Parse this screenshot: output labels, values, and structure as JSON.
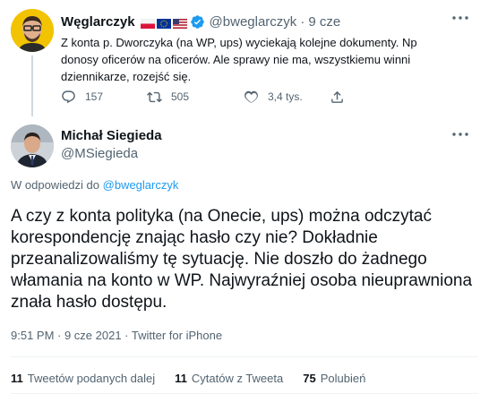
{
  "parent_tweet": {
    "author_name": "Węglarczyk",
    "handle": "@bweglarczyk",
    "separator": "·",
    "time": "9 cze",
    "text": "Z konta p. Dworczyka (na WP, ups) wyciekają kolejne dokumenty. Np donosy oficerów na oficerów. Ale sprawy nie ma, wszystkiemu winni dziennikarze, rozejść się.",
    "replies_count": "157",
    "retweets_count": "505",
    "likes_count": "3,4 tys.",
    "flags": [
      "poland-flag",
      "eu-flag",
      "us-flag"
    ],
    "icons": {
      "verified": "verified-badge-icon",
      "more": "more-icon",
      "reply": "reply-icon",
      "retweet": "retweet-icon",
      "like": "heart-icon",
      "share": "share-icon"
    }
  },
  "main_tweet": {
    "author_name": "Michał Siegieda",
    "handle": "@MSiegieda",
    "reply_prefix": "W odpowiedzi do ",
    "reply_handle": "@bweglarczyk",
    "text": "A czy z konta polityka (na Onecie, ups) można odczytać korespondencję znając hasło czy nie? Dokładnie przeanalizowaliśmy tę sytuację. Nie doszło do żadnego włamania na konto w WP. Najwyraźniej  osoba nieuprawniona znała hasło dostępu.",
    "meta": "9:51 PM · 9 cze 2021 · Twitter for iPhone",
    "stats": [
      {
        "count": "11",
        "label": "Tweetów podanych dalej"
      },
      {
        "count": "11",
        "label": "Cytatów z Tweeta"
      },
      {
        "count": "75",
        "label": "Polubień"
      }
    ]
  },
  "colors": {
    "text": "#0f1419",
    "secondary": "#536471",
    "link": "#1d9bf0",
    "verified": "#1d9bf0",
    "divider": "#eff3f4"
  }
}
